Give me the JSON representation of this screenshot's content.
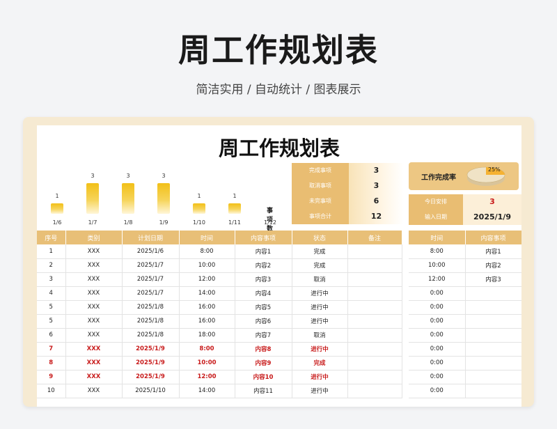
{
  "hero": {
    "title": "周工作规划表",
    "subtitle": "简洁实用 / 自动统计 / 图表展示"
  },
  "sheet": {
    "title": "周工作规划表"
  },
  "chart_data": {
    "type": "bar",
    "categories": [
      "1/6",
      "1/7",
      "1/8",
      "1/9",
      "1/10",
      "1/11",
      "1/12"
    ],
    "values": [
      1,
      3,
      3,
      3,
      1,
      1,
      0
    ],
    "legend": "事项数",
    "ylim": [
      0,
      3
    ],
    "color": "#f2c018"
  },
  "stats": [
    {
      "label": "完成事项",
      "value": "3"
    },
    {
      "label": "取消事项",
      "value": "3"
    },
    {
      "label": "未完事项",
      "value": "6"
    },
    {
      "label": "事项合计",
      "value": "12"
    }
  ],
  "completion": {
    "label": "工作完成率",
    "percent": "25%",
    "value": 0.25
  },
  "info": {
    "today_label": "今日安排",
    "today_value": "3",
    "date_label": "输入日期",
    "date_value": "2025/1/9"
  },
  "main_table": {
    "headers": [
      "序号",
      "类别",
      "计划日期",
      "时间",
      "内容事项",
      "状态",
      "备注"
    ],
    "rows": [
      [
        "1",
        "XXX",
        "2025/1/6",
        "8:00",
        "内容1",
        "完成",
        ""
      ],
      [
        "2",
        "XXX",
        "2025/1/7",
        "10:00",
        "内容2",
        "完成",
        ""
      ],
      [
        "3",
        "XXX",
        "2025/1/7",
        "12:00",
        "内容3",
        "取消",
        ""
      ],
      [
        "4",
        "XXX",
        "2025/1/7",
        "14:00",
        "内容4",
        "进行中",
        ""
      ],
      [
        "5",
        "XXX",
        "2025/1/8",
        "16:00",
        "内容5",
        "进行中",
        ""
      ],
      [
        "5",
        "XXX",
        "2025/1/8",
        "16:00",
        "内容6",
        "进行中",
        ""
      ],
      [
        "6",
        "XXX",
        "2025/1/8",
        "18:00",
        "内容7",
        "取消",
        ""
      ],
      [
        "7",
        "XXX",
        "2025/1/9",
        "8:00",
        "内容8",
        "进行中",
        ""
      ],
      [
        "8",
        "XXX",
        "2025/1/9",
        "10:00",
        "内容9",
        "完成",
        ""
      ],
      [
        "9",
        "XXX",
        "2025/1/9",
        "12:00",
        "内容10",
        "进行中",
        ""
      ],
      [
        "10",
        "XXX",
        "2025/1/10",
        "14:00",
        "内容11",
        "进行中",
        ""
      ]
    ],
    "highlight_rows": [
      7,
      8,
      9
    ],
    "highlight_color": "#c81a1a"
  },
  "side_table": {
    "headers": [
      "时间",
      "内容事项"
    ],
    "rows": [
      [
        "8:00",
        "内容1"
      ],
      [
        "10:00",
        "内容2"
      ],
      [
        "12:00",
        "内容3"
      ],
      [
        "0:00",
        ""
      ],
      [
        "0:00",
        ""
      ],
      [
        "0:00",
        ""
      ],
      [
        "0:00",
        ""
      ],
      [
        "0:00",
        ""
      ],
      [
        "0:00",
        ""
      ],
      [
        "0:00",
        ""
      ],
      [
        "0:00",
        ""
      ]
    ]
  }
}
